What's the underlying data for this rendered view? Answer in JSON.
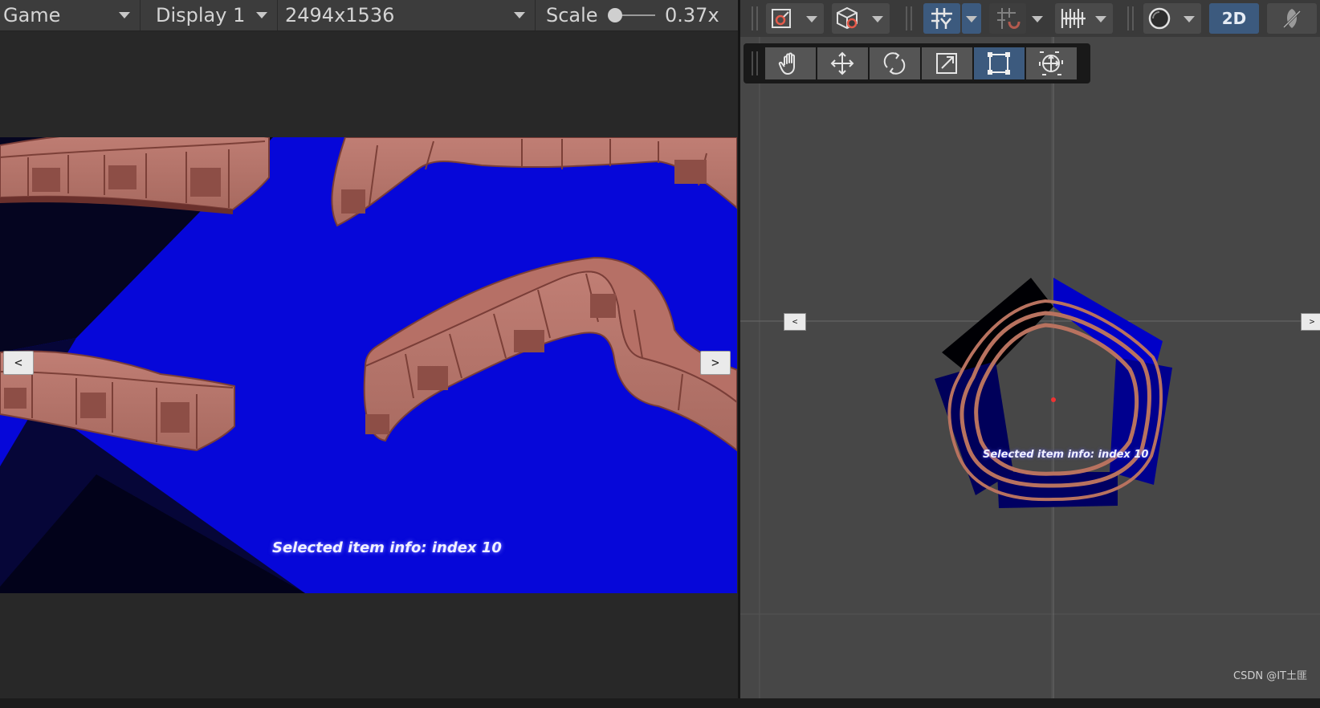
{
  "game_toolbar": {
    "view_label": "Game",
    "display_label": "Display 1",
    "resolution_label": "2494x1536",
    "scale_label": "Scale",
    "scale_value": "0.37x"
  },
  "game_view": {
    "background_color": "#0607d9",
    "prev_label": "<",
    "next_label": ">",
    "info_text": "Selected item info: index 10"
  },
  "scene_toolbar": {
    "mode_2d_label": "2D",
    "items": [
      "gizmo-icon",
      "cube-icon",
      "grid-snap-icon",
      "increment-snap-icon",
      "ruler-icon",
      "shading-sphere-icon",
      "2D",
      "effects-icon"
    ]
  },
  "tools": [
    "hand-tool",
    "move-tool",
    "rotate-tool",
    "scale-tool",
    "rect-tool",
    "transform-tool"
  ],
  "scene_view": {
    "info_text": "Selected item info: index 10",
    "prev_label": "<",
    "next_label": ">"
  },
  "watermark": "CSDN @IT土匪"
}
